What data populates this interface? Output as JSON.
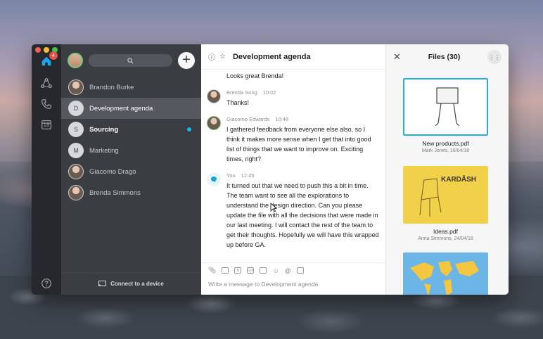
{
  "rail": {
    "home_badge": "4",
    "calendar_day": "18"
  },
  "sidebar": {
    "items": [
      {
        "label": "Brandon Burke",
        "type": "photo"
      },
      {
        "label": "Development agenda",
        "avatar_text": "D",
        "type": "letter",
        "active": true
      },
      {
        "label": "Sourcing",
        "avatar_text": "S",
        "type": "letter",
        "bold": true,
        "unread": true
      },
      {
        "label": "Marketing",
        "avatar_text": "M",
        "type": "letter"
      },
      {
        "label": "Giacomo Drago",
        "type": "photo"
      },
      {
        "label": "Brenda Simmons",
        "type": "photo"
      }
    ],
    "connect_label": "Connect to a device"
  },
  "chat": {
    "title": "Development agenda",
    "messages": [
      {
        "text": "Looks great Brenda!"
      },
      {
        "author": "Brenda Song",
        "time": "10:02",
        "text": "Thanks!"
      },
      {
        "author": "Giacomo Edwards",
        "time": "10:48",
        "text": "I gathered feedback from everyone else also, so I think it makes more sense when I get that into good list of things that we want to improve on. Exciting times, right?"
      },
      {
        "author": "You",
        "time": "12:45",
        "text": "It turned out that we need to push this a bit in time. The team want to see all the explorations to understand the design direction. Can you please update the file with all the decisions that were made in our last meeting. I will contact the rest of the team to get their thoughts. Hopefully we will have this wrapped up before GA."
      }
    ],
    "composer_placeholder": "Write a message to Development agenda"
  },
  "files": {
    "title": "Files (30)",
    "items": [
      {
        "name": "New products.pdf",
        "meta": "Mark Jones, 16/04/18"
      },
      {
        "name": "Ideas.pdf",
        "meta": "Anna Simmons, 24/04/18",
        "thumb_text": "KARDÅSH"
      },
      {
        "name": "",
        "meta": ""
      }
    ]
  },
  "colors": {
    "accent": "#17b4ec",
    "unread": "#17b4ec",
    "badge": "#e9524a",
    "sidebar_bg": "#3a3d42",
    "rail_bg": "#26282c"
  }
}
